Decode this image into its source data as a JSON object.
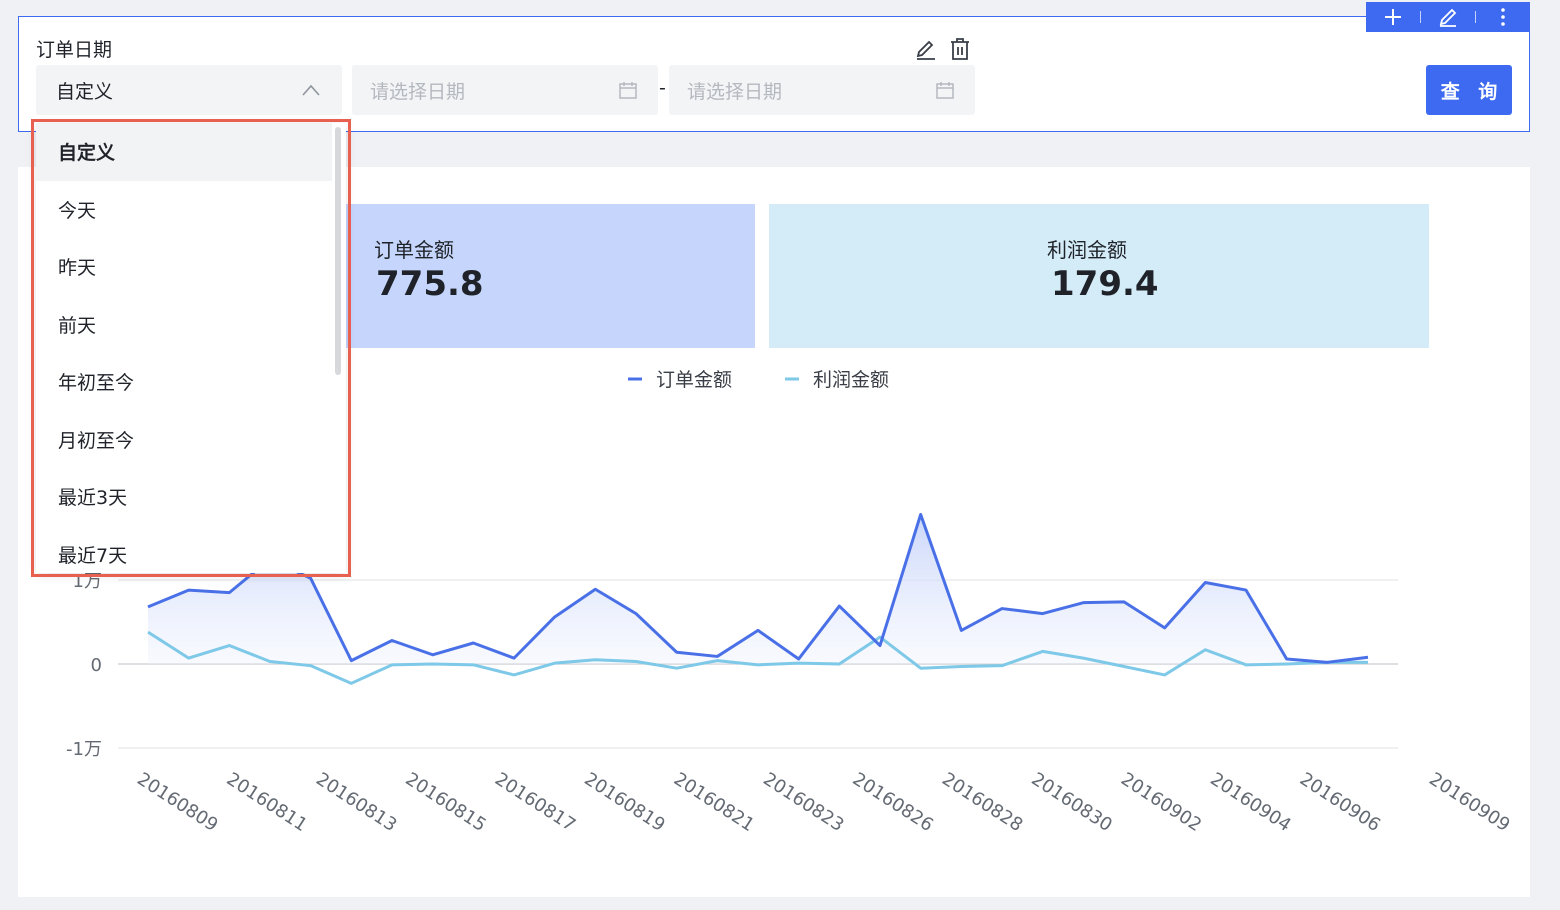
{
  "filter": {
    "label": "订单日期",
    "select_value": "自定义",
    "start_placeholder": "请选择日期",
    "end_placeholder": "请选择日期",
    "date_separator": "-",
    "query_button": "查 询"
  },
  "dropdown": {
    "options": [
      "自定义",
      "今天",
      "昨天",
      "前天",
      "年初至今",
      "月初至今",
      "最近3天",
      "最近7天"
    ],
    "selected": "自定义"
  },
  "kpis": [
    {
      "title": "订单金额",
      "value": "775.8"
    },
    {
      "title": "利润金额",
      "value": "179.4"
    }
  ],
  "colors": {
    "accent": "#3d6af0",
    "order_line": "#4a70e8",
    "profit_line": "#7ec8e8",
    "kpi_order_bg": "#c5d5fb",
    "kpi_profit_bg": "#d4ecf8",
    "highlight": "#e8604f"
  },
  "icons": {
    "toolbar": [
      "plus-icon",
      "edit-icon",
      "more-vertical-icon"
    ],
    "filter_actions": [
      "edit-icon",
      "trash-icon"
    ],
    "select_arrow": "chevron-up-icon",
    "date": "calendar-icon"
  },
  "chart_data": {
    "type": "area",
    "legend": [
      "订单金额",
      "利润金额"
    ],
    "legend_position": "top-center",
    "y_ticks": [
      "-1万",
      "0",
      "1万"
    ],
    "y_tick_values": [
      -10000,
      0,
      10000
    ],
    "x_tick_labels": [
      "20160809",
      "20160811",
      "20160813",
      "20160815",
      "20160817",
      "20160819",
      "20160821",
      "20160823",
      "20160826",
      "20160828",
      "20160830",
      "20160902",
      "20160904",
      "20160906",
      "20160909"
    ],
    "series": [
      {
        "name": "订单金额",
        "values": [
          6800,
          8800,
          8500,
          12500,
          10200,
          400,
          2800,
          1100,
          2500,
          700,
          5600,
          8900,
          6000,
          1400,
          900,
          4000,
          600,
          6900,
          2200,
          17800,
          4000,
          6600,
          6000,
          7300,
          7400,
          4300,
          9700,
          8800,
          600,
          200,
          800
        ]
      },
      {
        "name": "利润金额",
        "values": [
          3800,
          700,
          2200,
          300,
          -200,
          -2300,
          -100,
          0,
          -100,
          -1300,
          100,
          500,
          300,
          -500,
          400,
          -100,
          100,
          0,
          3200,
          -500,
          -300,
          -200,
          1500,
          700,
          -300,
          -1300,
          1700,
          -100,
          0,
          200,
          200
        ]
      }
    ],
    "ylim": [
      -10000,
      18000
    ],
    "grid": true
  }
}
